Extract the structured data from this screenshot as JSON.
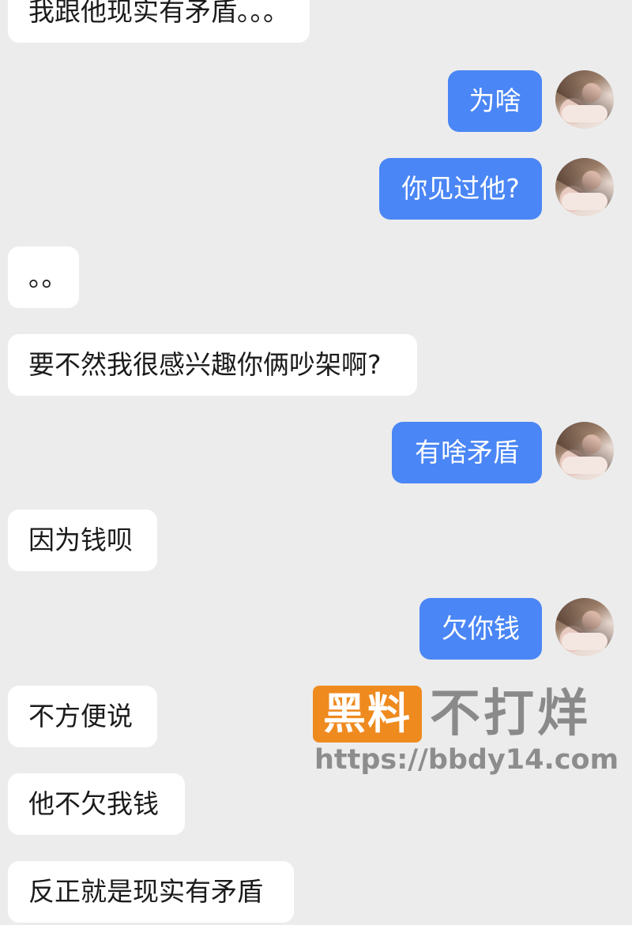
{
  "messages": [
    {
      "side": "in",
      "text": "我跟他现实有矛盾。。。"
    },
    {
      "side": "out",
      "text": "为啥"
    },
    {
      "side": "out",
      "text": "你见过他?"
    },
    {
      "side": "in",
      "text": "。。"
    },
    {
      "side": "in",
      "text": "要不然我很感兴趣你俩吵架啊?"
    },
    {
      "side": "out",
      "text": "有啥矛盾"
    },
    {
      "side": "in",
      "text": "因为钱呗"
    },
    {
      "side": "out",
      "text": "欠你钱"
    },
    {
      "side": "in",
      "text": "不方便说"
    },
    {
      "side": "in",
      "text": "他不欠我钱"
    },
    {
      "side": "in",
      "text": "反正就是现实有矛盾"
    }
  ],
  "watermark": {
    "badge": "黑料",
    "title": "不打烊",
    "url": "https://bbdy14.com"
  },
  "colors": {
    "background": "#ececed",
    "incoming_bubble": "#ffffff",
    "outgoing_bubble": "#4a86f5",
    "watermark_badge": "#ef8a1f"
  }
}
